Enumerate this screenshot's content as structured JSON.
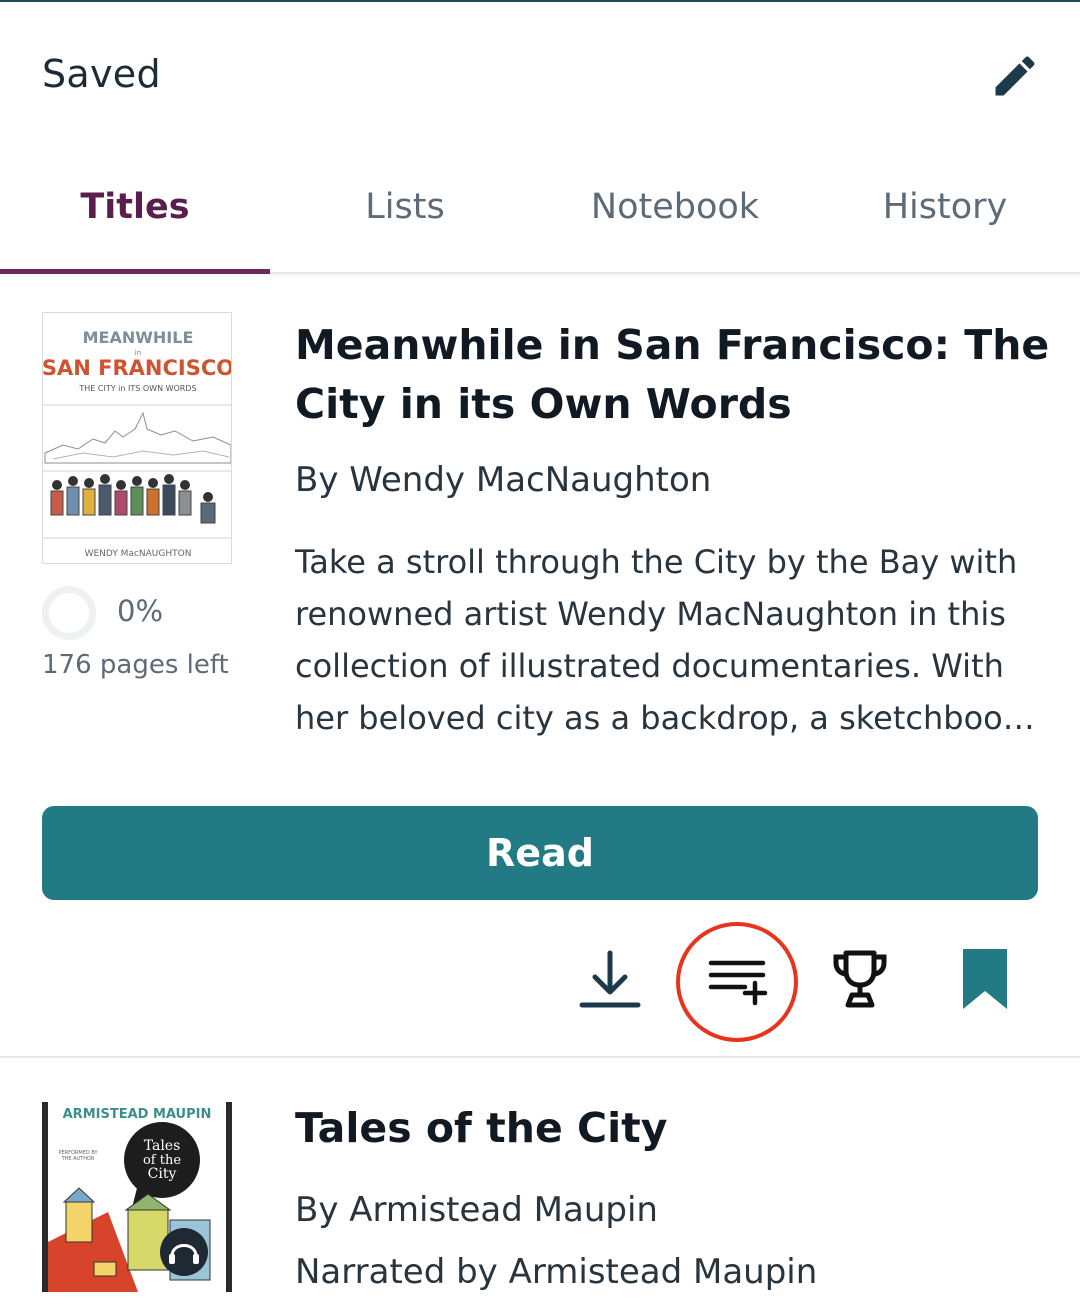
{
  "header": {
    "title": "Saved",
    "edit_icon": "pencil-icon"
  },
  "tabs": [
    {
      "label": "Titles",
      "active": true
    },
    {
      "label": "Lists",
      "active": false
    },
    {
      "label": "Notebook",
      "active": false
    },
    {
      "label": "History",
      "active": false
    }
  ],
  "books": [
    {
      "title": "Meanwhile in San Francisco: The City in its Own Words",
      "author": "By Wendy MacNaughton",
      "description": "Take a stroll through the City by the Bay with renowned artist Wendy MacNaughton in this collection of illustrated documentaries. With her beloved city as a backdrop, a sketchboo…",
      "progress_percent": "0%",
      "progress_value": 0,
      "pages_left": "176 pages left",
      "read_label": "Read",
      "cover": {
        "line1": "MEANWHILE",
        "line2": "in",
        "line3": "SAN FRANCISCO",
        "line4": "THE CITY in ITS OWN WORDS",
        "line5": "WENDY MacNAUGHTON"
      },
      "actions": [
        "download-icon",
        "add-to-list-icon",
        "trophy-icon",
        "bookmark-icon"
      ]
    },
    {
      "title": "Tales of the City",
      "author": "By Armistead Maupin",
      "narrator": "Narrated by Armistead Maupin",
      "cover": {
        "top": "ARMISTEAD MAUPIN",
        "bubble1": "Tales",
        "bubble2": "of the",
        "bubble3": "City",
        "small1": "PERFORMED BY",
        "small2": "THE AUTHOR"
      }
    }
  ],
  "colors": {
    "accent_tab": "#6b2a5c",
    "read_button": "#217a84",
    "highlight": "#e8341d",
    "bookmark": "#217a84"
  }
}
